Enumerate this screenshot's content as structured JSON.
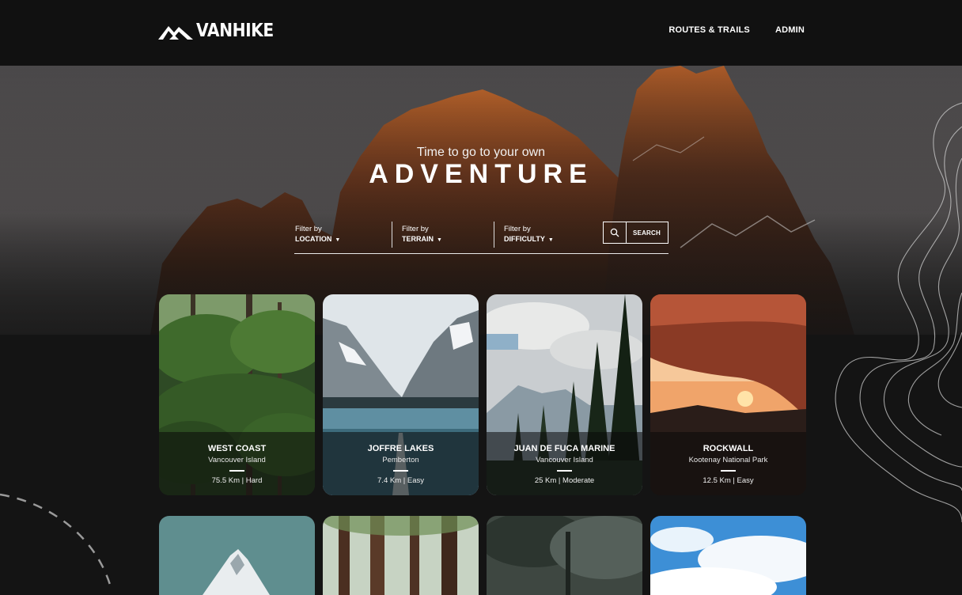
{
  "brand": {
    "name": "VANHIKE"
  },
  "nav": {
    "items": [
      "ROUTES & TRAILS",
      "ADMIN"
    ]
  },
  "hero": {
    "tagline": "Time to go to your own",
    "headline": "ADVENTURE"
  },
  "filters": [
    {
      "label": "Filter by",
      "value": "LOCATION"
    },
    {
      "label": "Filter by",
      "value": "TERRAIN"
    },
    {
      "label": "Filter by",
      "value": "DIFFICULTY"
    }
  ],
  "search": {
    "button_label": "SEARCH"
  },
  "trails": [
    {
      "title": "WEST COAST",
      "location": "Vancouver Island",
      "meta": "75.5 Km | Hard"
    },
    {
      "title": "JOFFRE LAKES",
      "location": "Pemberton",
      "meta": "7.4 Km | Easy"
    },
    {
      "title": "JUAN DE FUCA MARINE",
      "location": "Vancouver Island",
      "meta": "25 Km | Moderate"
    },
    {
      "title": "ROCKWALL",
      "location": "Kootenay National Park",
      "meta": "12.5 Km | Easy"
    }
  ],
  "icons": [
    "logo-mountain-icon",
    "search-icon",
    "caret-down-icon",
    "topo-map-decoration",
    "dashed-trail-decoration"
  ]
}
